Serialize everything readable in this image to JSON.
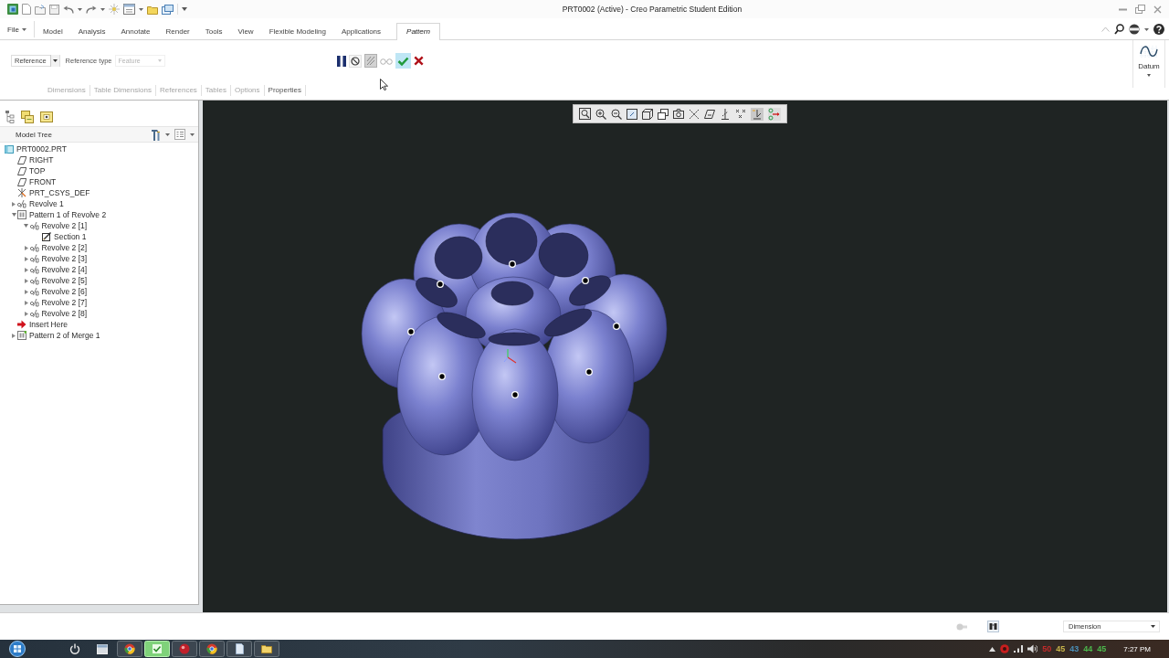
{
  "window": {
    "title": "PRT0002 (Active) - Creo Parametric Student Edition"
  },
  "ribbon": {
    "file_menu": {
      "label": "File"
    },
    "tabs": [
      {
        "label": "Model",
        "selected": false
      },
      {
        "label": "Analysis",
        "selected": false
      },
      {
        "label": "Annotate",
        "selected": false
      },
      {
        "label": "Render",
        "selected": false
      },
      {
        "label": "Tools",
        "selected": false
      },
      {
        "label": "View",
        "selected": false
      },
      {
        "label": "Flexible Modeling",
        "selected": false
      },
      {
        "label": "Applications",
        "selected": false
      },
      {
        "label": "Pattern",
        "selected": true
      }
    ]
  },
  "dashboard": {
    "reference_menu": {
      "value": "Reference"
    },
    "reference_type": {
      "label": "Reference type",
      "value": "Feature",
      "disabled": true
    },
    "panel_tabs": [
      {
        "label": "Dimensions",
        "disabled": true
      },
      {
        "label": "Table Dimensions",
        "disabled": true
      },
      {
        "label": "References",
        "disabled": true
      },
      {
        "label": "Tables",
        "disabled": true
      },
      {
        "label": "Options",
        "disabled": true
      },
      {
        "label": "Properties",
        "disabled": false
      }
    ],
    "datum_group": {
      "label": "Datum"
    }
  },
  "model_tree": {
    "title": "Model Tree",
    "items": [
      {
        "label": "PRT0002.PRT",
        "kind": "part",
        "children": [
          {
            "label": "RIGHT",
            "kind": "plane"
          },
          {
            "label": "TOP",
            "kind": "plane"
          },
          {
            "label": "FRONT",
            "kind": "plane"
          },
          {
            "label": "PRT_CSYS_DEF",
            "kind": "csys"
          },
          {
            "label": "Revolve 1",
            "kind": "revolve",
            "expanded": false
          },
          {
            "label": "Pattern 1 of Revolve 2",
            "kind": "pattern",
            "expanded": true,
            "children": [
              {
                "label": "Revolve 2 [1]",
                "kind": "revolve",
                "expanded": true,
                "children": [
                  {
                    "label": "Section 1",
                    "kind": "sketch"
                  }
                ]
              },
              {
                "label": "Revolve 2 [2]",
                "kind": "revolve",
                "expanded": false
              },
              {
                "label": "Revolve 2 [3]",
                "kind": "revolve",
                "expanded": false
              },
              {
                "label": "Revolve 2 [4]",
                "kind": "revolve",
                "expanded": false
              },
              {
                "label": "Revolve 2 [5]",
                "kind": "revolve",
                "expanded": false
              },
              {
                "label": "Revolve 2 [6]",
                "kind": "revolve",
                "expanded": false
              },
              {
                "label": "Revolve 2 [7]",
                "kind": "revolve",
                "expanded": false
              },
              {
                "label": "Revolve 2 [8]",
                "kind": "revolve",
                "expanded": false
              }
            ]
          },
          {
            "label": "Insert Here",
            "kind": "insert"
          },
          {
            "label": "Pattern 2 of Merge 1",
            "kind": "merge",
            "expanded": false
          }
        ]
      }
    ]
  },
  "status_bar": {
    "selection_filter": "Dimension"
  },
  "taskbar": {
    "tray_readings": [
      {
        "text": "50",
        "color": "#c42a2a"
      },
      {
        "text": "45",
        "color": "#c8b44a"
      },
      {
        "text": "43",
        "color": "#4a8fb8"
      },
      {
        "text": "44",
        "color": "#4cb84c"
      },
      {
        "text": "45",
        "color": "#4cb84c"
      }
    ],
    "clock": "7:27 PM"
  }
}
